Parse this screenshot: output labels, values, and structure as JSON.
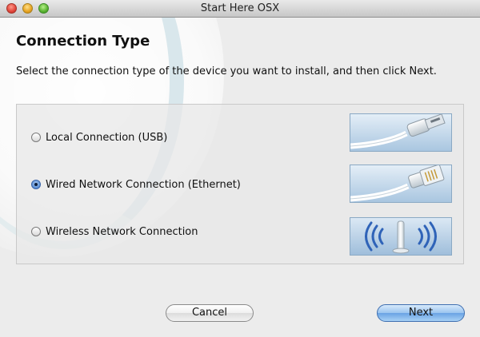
{
  "window": {
    "title": "Start Here OSX"
  },
  "page": {
    "heading": "Connection Type",
    "instruction": "Select the connection type of the device you want to install, and then click Next."
  },
  "options": [
    {
      "label": "Local Connection (USB)",
      "selected": false,
      "image": "usb-cable-icon"
    },
    {
      "label": "Wired Network Connection (Ethernet)",
      "selected": true,
      "image": "ethernet-cable-icon"
    },
    {
      "label": "Wireless Network Connection",
      "selected": false,
      "image": "wireless-icon"
    }
  ],
  "buttons": {
    "cancel": "Cancel",
    "next": "Next"
  },
  "colors": {
    "accent": "#5b8fd6",
    "thumb_bg": "#c9dff0"
  }
}
